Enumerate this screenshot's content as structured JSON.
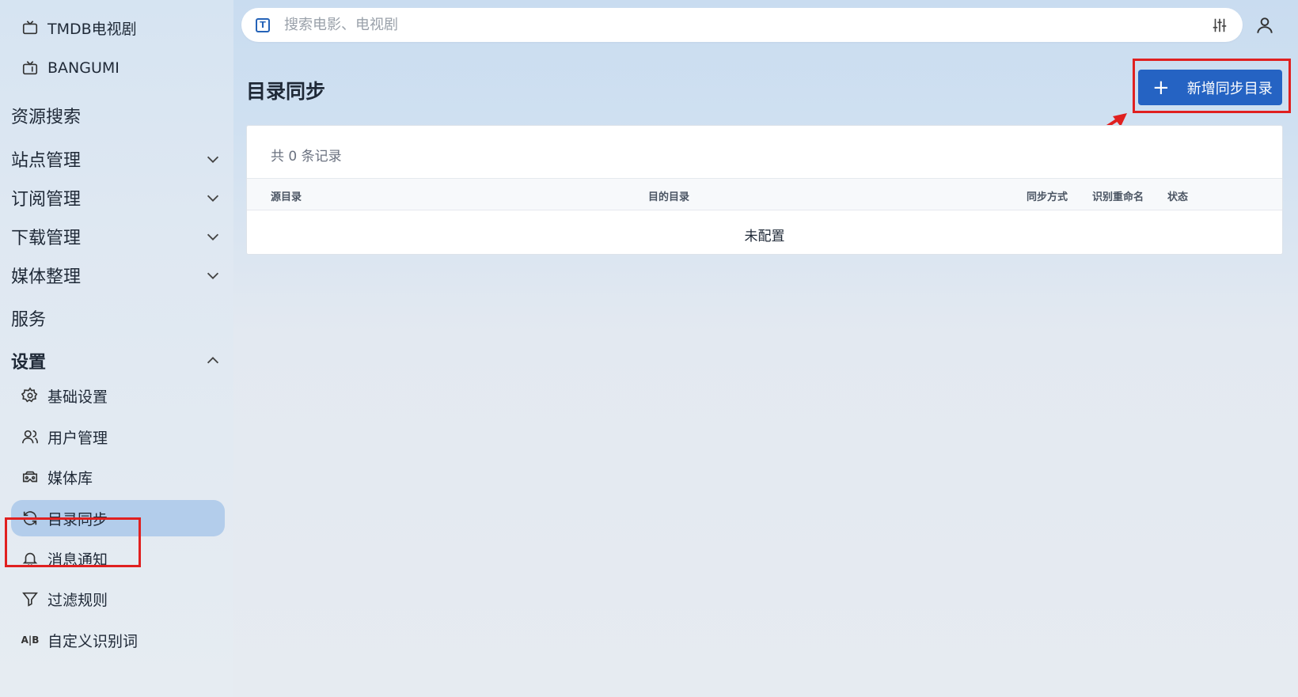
{
  "sidebar": {
    "top_items": [
      {
        "label": "TMDB电视剧",
        "icon": "tv-icon"
      },
      {
        "label": "BANGUMI",
        "icon": "tv-retro-icon"
      }
    ],
    "groups": {
      "search": "资源搜索",
      "sites": "站点管理",
      "subscribe": "订阅管理",
      "download": "下载管理",
      "media": "媒体整理",
      "service": "服务",
      "settings": "设置"
    },
    "settings_items": [
      {
        "label": "基础设置",
        "icon": "gear-icon"
      },
      {
        "label": "用户管理",
        "icon": "users-icon"
      },
      {
        "label": "媒体库",
        "icon": "cardboard-icon"
      },
      {
        "label": "目录同步",
        "icon": "sync-icon",
        "active": true
      },
      {
        "label": "消息通知",
        "icon": "bell-icon"
      },
      {
        "label": "过滤规则",
        "icon": "filter-icon"
      },
      {
        "label": "自定义识别词",
        "icon": "ab-icon"
      }
    ]
  },
  "search": {
    "placeholder": "搜索电影、电视剧"
  },
  "page": {
    "title": "目录同步",
    "add_button": "新增同步目录",
    "record_count": "共 0 条记录",
    "columns": [
      "源目录",
      "目的目录",
      "同步方式",
      "识别重命名",
      "状态"
    ],
    "empty_text": "未配置"
  },
  "colors": {
    "accent": "#2563c3",
    "highlight": "#e02020",
    "active_nav": "#b3cdeb"
  }
}
